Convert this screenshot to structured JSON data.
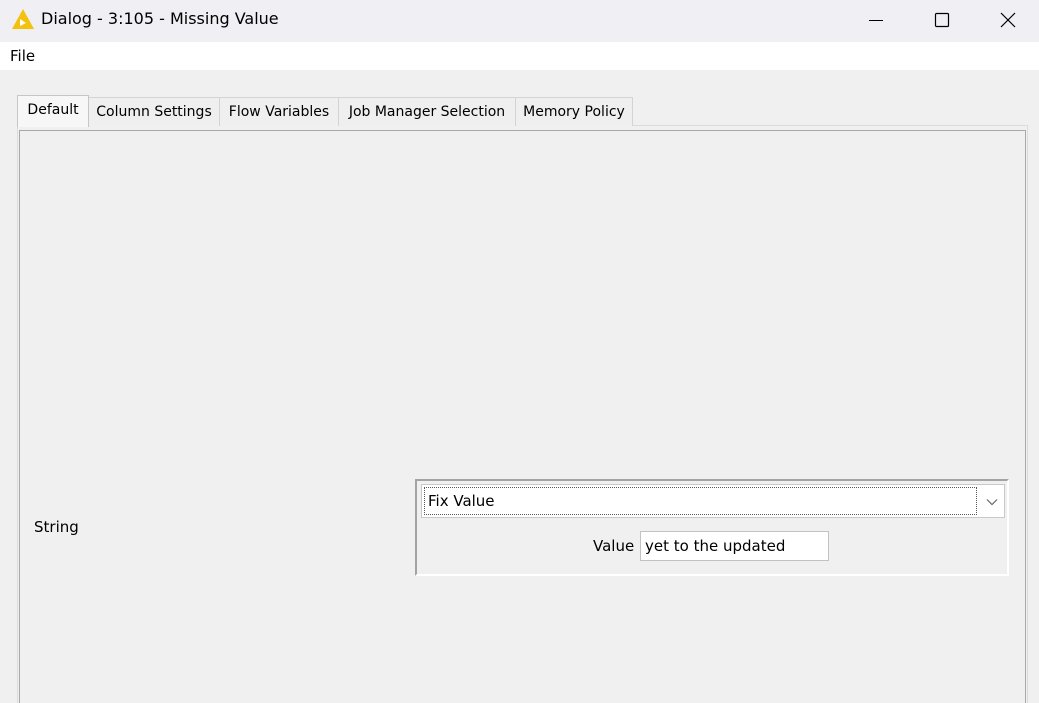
{
  "window": {
    "title": "Dialog - 3:105 - Missing Value",
    "icon": "knime-triangle-icon",
    "accent_color": "#f4c20d",
    "controls": {
      "minimize": "minimize-icon",
      "maximize": "maximize-icon",
      "close": "close-icon"
    }
  },
  "menubar": {
    "items": [
      {
        "label": "File"
      }
    ]
  },
  "tabs": [
    {
      "label": "Default",
      "active": true
    },
    {
      "label": "Column Settings",
      "active": false
    },
    {
      "label": "Flow Variables",
      "active": false
    },
    {
      "label": "Job Manager Selection",
      "active": false
    },
    {
      "label": "Memory Policy",
      "active": false
    }
  ],
  "default_tab": {
    "row_label": "String",
    "handler": {
      "selected": "Fix Value",
      "value_label": "Value",
      "value": "yet to the updated"
    }
  }
}
